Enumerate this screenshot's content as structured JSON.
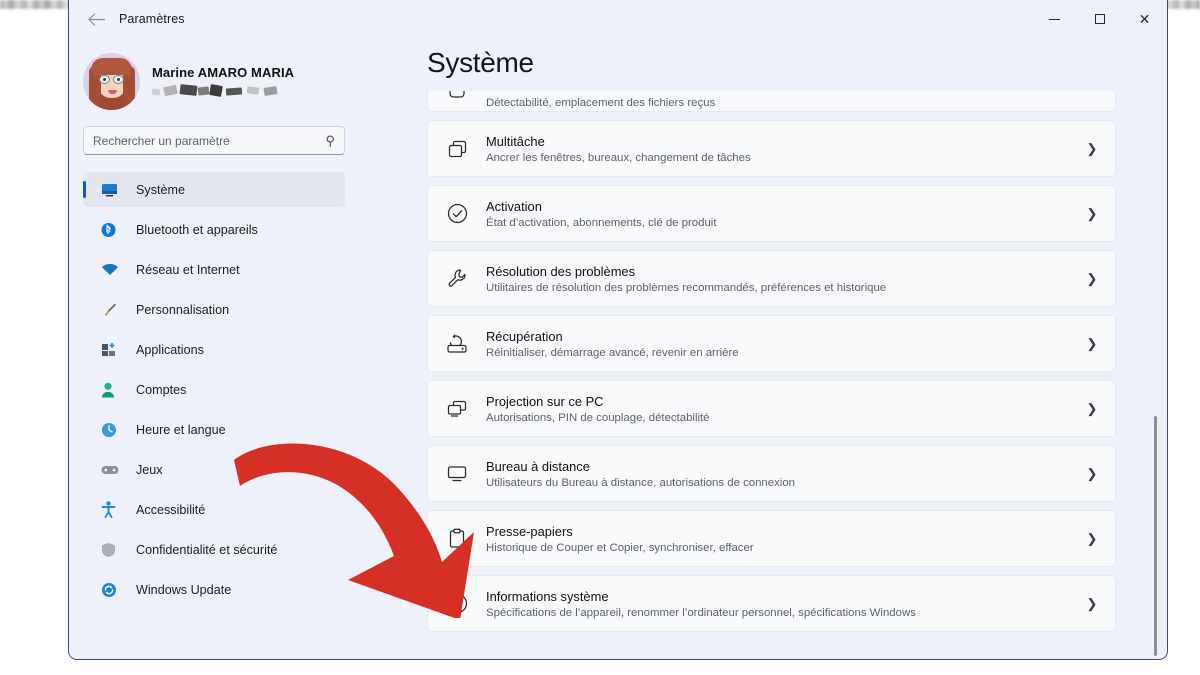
{
  "window": {
    "title": "Paramètres",
    "back_icon": "arrow-left-icon",
    "controls": {
      "minimize": "–",
      "maximize": "□",
      "close": "✕"
    }
  },
  "profile": {
    "name": "Marine AMARO MARIA",
    "avatar_icon": "user-avatar-memoji",
    "account_line_redacted": true
  },
  "search": {
    "placeholder": "Rechercher un paramètre",
    "value": "",
    "icon": "search-icon"
  },
  "sidebar": {
    "items": [
      {
        "label": "Système",
        "icon": "monitor-icon",
        "active": true
      },
      {
        "label": "Bluetooth et appareils",
        "icon": "bluetooth-icon",
        "active": false
      },
      {
        "label": "Réseau et Internet",
        "icon": "wifi-icon",
        "active": false
      },
      {
        "label": "Personnalisation",
        "icon": "paintbrush-icon",
        "active": false
      },
      {
        "label": "Applications",
        "icon": "apps-grid-icon",
        "active": false
      },
      {
        "label": "Comptes",
        "icon": "person-icon",
        "active": false
      },
      {
        "label": "Heure et langue",
        "icon": "clock-globe-icon",
        "active": false
      },
      {
        "label": "Jeux",
        "icon": "gamepad-icon",
        "active": false
      },
      {
        "label": "Accessibilité",
        "icon": "accessibility-person-icon",
        "active": false
      },
      {
        "label": "Confidentialité et sécurité",
        "icon": "shield-icon",
        "active": false
      },
      {
        "label": "Windows Update",
        "icon": "refresh-circle-icon",
        "active": false
      }
    ]
  },
  "main": {
    "title": "Système",
    "chevron_icon": "chevron-right-icon",
    "cards": [
      {
        "title": "",
        "subtitle": "Détectabilité, emplacement des fichiers reçus",
        "icon": "share-nearby-icon",
        "clipped": true
      },
      {
        "title": "Multitâche",
        "subtitle": "Ancrer les fenêtres, bureaux, changement de tâches",
        "icon": "windows-stack-icon",
        "clipped": false
      },
      {
        "title": "Activation",
        "subtitle": "État d’activation, abonnements, clé de produit",
        "icon": "check-circle-icon",
        "clipped": false
      },
      {
        "title": "Résolution des problèmes",
        "subtitle": "Utilitaires de résolution des problèmes recommandés, préférences et historique",
        "icon": "wrench-icon",
        "clipped": false
      },
      {
        "title": "Récupération",
        "subtitle": "Réinitialiser, démarrage avancé, revenir en arrière",
        "icon": "recovery-reset-icon",
        "clipped": false
      },
      {
        "title": "Projection sur ce PC",
        "subtitle": "Autorisations, PIN de couplage, détectabilité",
        "icon": "project-screens-icon",
        "clipped": false
      },
      {
        "title": "Bureau à distance",
        "subtitle": "Utilisateurs du Bureau à distance, autorisations de connexion",
        "icon": "remote-desktop-icon",
        "clipped": false
      },
      {
        "title": "Presse-papiers",
        "subtitle": "Historique de Couper et Copier, synchroniser, effacer",
        "icon": "clipboard-icon",
        "clipped": false
      },
      {
        "title": "Informations système",
        "subtitle": "Spécifications de l’appareil, renommer l’ordinateur personnel, spécifications Windows",
        "icon": "info-circle-icon",
        "clipped": false
      }
    ]
  },
  "annotation": {
    "arrow_color": "#d62f26",
    "arrow_name": "red-pointer-arrow",
    "points_to": "Informations système"
  },
  "colors": {
    "sidebar_bg": "#eef1f9",
    "card_bg": "#f9fafc",
    "accent": "#0a5bd3",
    "window_border": "#3b4a77"
  }
}
